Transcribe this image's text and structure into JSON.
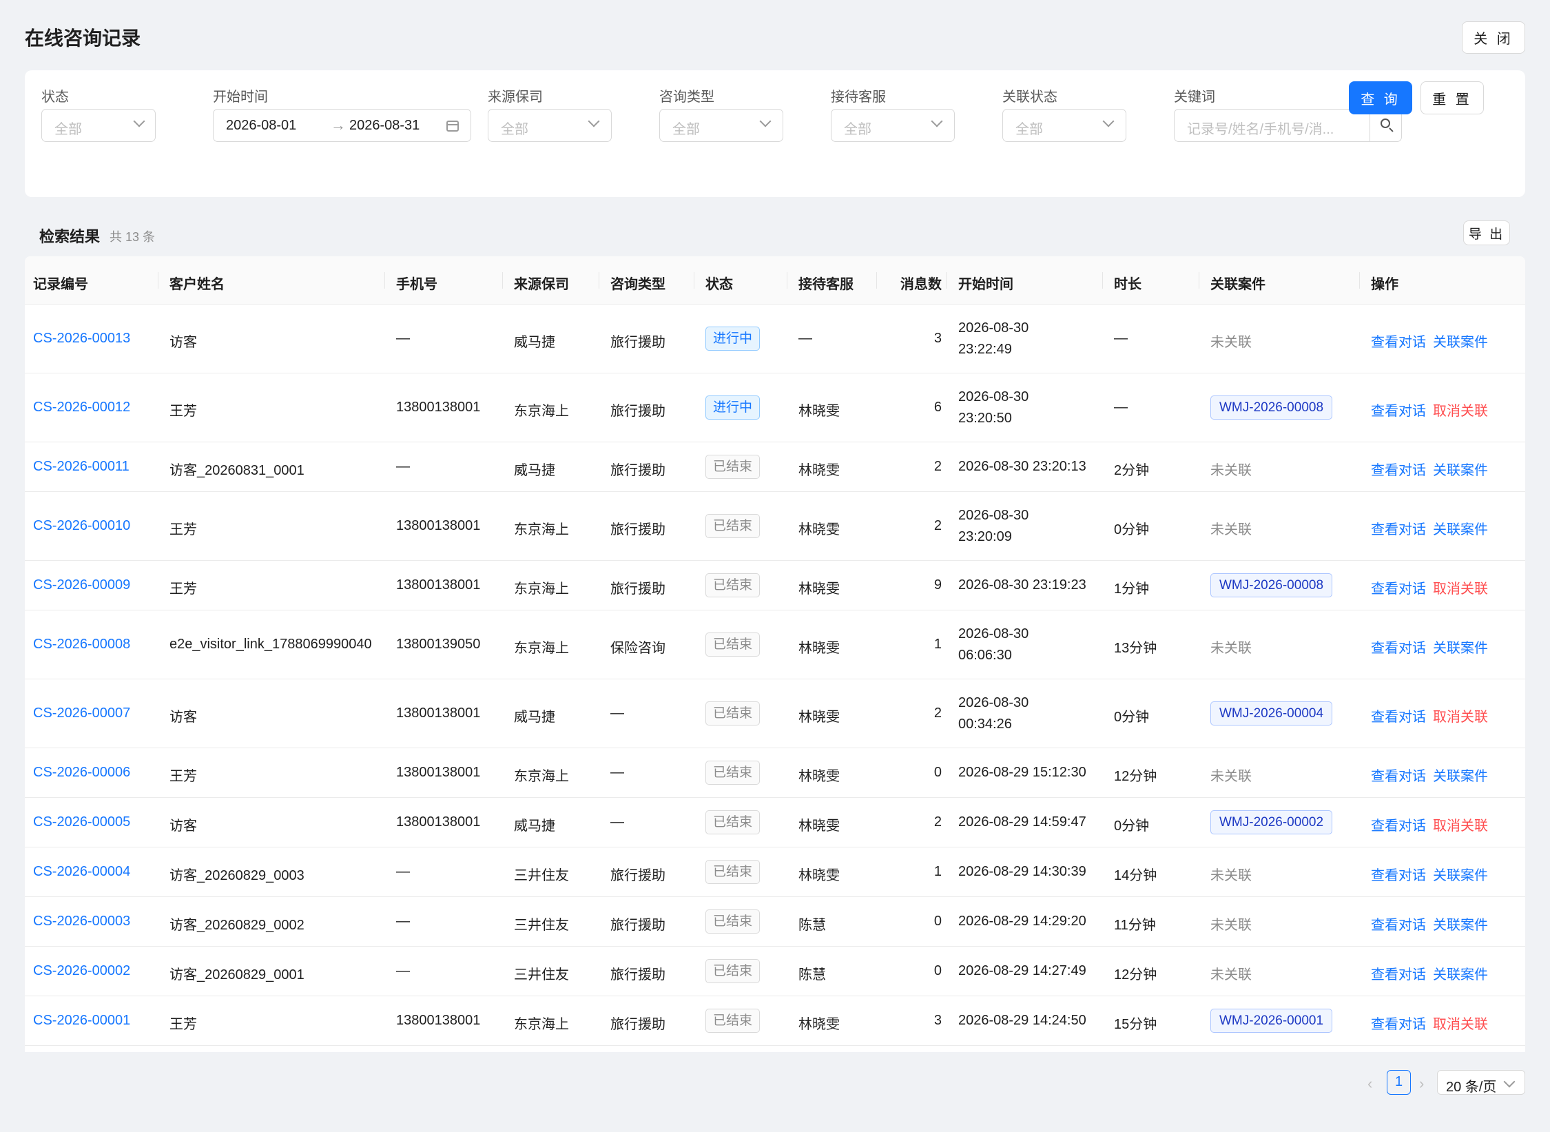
{
  "page": {
    "title": "在线咨询记录",
    "close_label": "关 闭"
  },
  "filters": {
    "status": {
      "label": "状态",
      "placeholder": "全部"
    },
    "start_time": {
      "label": "开始时间",
      "from": "2026-08-01",
      "to": "2026-08-31"
    },
    "insurer": {
      "label": "来源保司",
      "placeholder": "全部"
    },
    "consult_type": {
      "label": "咨询类型",
      "placeholder": "全部"
    },
    "agent": {
      "label": "接待客服",
      "placeholder": "全部"
    },
    "link_status": {
      "label": "关联状态",
      "placeholder": "全部"
    },
    "keyword": {
      "label": "关键词",
      "placeholder": "记录号/姓名/手机号/消..."
    },
    "query_label": "查 询",
    "reset_label": "重 置"
  },
  "results": {
    "title": "检索结果",
    "count": "共 13 条",
    "export_label": "导 出"
  },
  "table": {
    "columns": [
      "记录编号",
      "客户姓名",
      "手机号",
      "来源保司",
      "咨询类型",
      "状态",
      "接待客服",
      "消息数",
      "开始时间",
      "时长",
      "关联案件",
      "操作"
    ],
    "rows": [
      {
        "id": "CS-2026-00013",
        "name": "访客",
        "phone": "—",
        "insurer": "威马捷",
        "type": "旅行援助",
        "status": "进行中",
        "running": true,
        "agent": "—",
        "messages": "3",
        "date": "2026-08-30",
        "clock": "23:22:49",
        "duration": "—",
        "case": "未关联",
        "linked": false,
        "view": "查看对话",
        "action": "关联案件"
      },
      {
        "id": "CS-2026-00012",
        "name": "王芳",
        "phone": "13800138001",
        "insurer": "东京海上",
        "type": "旅行援助",
        "status": "进行中",
        "running": true,
        "agent": "林晓雯",
        "messages": "6",
        "date": "2026-08-30",
        "clock": "23:20:50",
        "duration": "—",
        "case": "WMJ-2026-00008",
        "linked": true,
        "view": "查看对话",
        "action": "取消关联"
      },
      {
        "id": "CS-2026-00011",
        "name": "访客_20260831_0001",
        "phone": "—",
        "insurer": "威马捷",
        "type": "旅行援助",
        "status": "已结束",
        "running": false,
        "agent": "林晓雯",
        "messages": "2",
        "datetime": "2026-08-30 23:20:13",
        "duration": "2分钟",
        "case": "未关联",
        "linked": false,
        "view": "查看对话",
        "action": "关联案件"
      },
      {
        "id": "CS-2026-00010",
        "name": "王芳",
        "phone": "13800138001",
        "insurer": "东京海上",
        "type": "旅行援助",
        "status": "已结束",
        "running": false,
        "agent": "林晓雯",
        "messages": "2",
        "date": "2026-08-30",
        "clock": "23:20:09",
        "duration": "0分钟",
        "case": "未关联",
        "linked": false,
        "view": "查看对话",
        "action": "关联案件"
      },
      {
        "id": "CS-2026-00009",
        "name": "王芳",
        "phone": "13800138001",
        "insurer": "东京海上",
        "type": "旅行援助",
        "status": "已结束",
        "running": false,
        "agent": "林晓雯",
        "messages": "9",
        "datetime": "2026-08-30 23:19:23",
        "duration": "1分钟",
        "case": "WMJ-2026-00008",
        "linked": true,
        "view": "查看对话",
        "action": "取消关联"
      },
      {
        "id": "CS-2026-00008",
        "name": "e2e_visitor_link_1788069990040",
        "phone": "13800139050",
        "insurer": "东京海上",
        "type": "保险咨询",
        "status": "已结束",
        "running": false,
        "agent": "林晓雯",
        "messages": "1",
        "date": "2026-08-30",
        "clock": "06:06:30",
        "duration": "13分钟",
        "case": "未关联",
        "linked": false,
        "view": "查看对话",
        "action": "关联案件"
      },
      {
        "id": "CS-2026-00007",
        "name": "访客",
        "phone": "13800138001",
        "insurer": "威马捷",
        "type": "—",
        "status": "已结束",
        "running": false,
        "agent": "林晓雯",
        "messages": "2",
        "date": "2026-08-30",
        "clock": "00:34:26",
        "duration": "0分钟",
        "case": "WMJ-2026-00004",
        "linked": true,
        "view": "查看对话",
        "action": "取消关联"
      },
      {
        "id": "CS-2026-00006",
        "name": "王芳",
        "phone": "13800138001",
        "insurer": "东京海上",
        "type": "—",
        "status": "已结束",
        "running": false,
        "agent": "林晓雯",
        "messages": "0",
        "datetime": "2026-08-29 15:12:30",
        "duration": "12分钟",
        "case": "未关联",
        "linked": false,
        "view": "查看对话",
        "action": "关联案件"
      },
      {
        "id": "CS-2026-00005",
        "name": "访客",
        "phone": "13800138001",
        "insurer": "威马捷",
        "type": "—",
        "status": "已结束",
        "running": false,
        "agent": "林晓雯",
        "messages": "2",
        "datetime": "2026-08-29 14:59:47",
        "duration": "0分钟",
        "case": "WMJ-2026-00002",
        "linked": true,
        "view": "查看对话",
        "action": "取消关联"
      },
      {
        "id": "CS-2026-00004",
        "name": "访客_20260829_0003",
        "phone": "—",
        "insurer": "三井住友",
        "type": "旅行援助",
        "status": "已结束",
        "running": false,
        "agent": "林晓雯",
        "messages": "1",
        "datetime": "2026-08-29 14:30:39",
        "duration": "14分钟",
        "case": "未关联",
        "linked": false,
        "view": "查看对话",
        "action": "关联案件"
      },
      {
        "id": "CS-2026-00003",
        "name": "访客_20260829_0002",
        "phone": "—",
        "insurer": "三井住友",
        "type": "旅行援助",
        "status": "已结束",
        "running": false,
        "agent": "陈慧",
        "messages": "0",
        "datetime": "2026-08-29 14:29:20",
        "duration": "11分钟",
        "case": "未关联",
        "linked": false,
        "view": "查看对话",
        "action": "关联案件"
      },
      {
        "id": "CS-2026-00002",
        "name": "访客_20260829_0001",
        "phone": "—",
        "insurer": "三井住友",
        "type": "旅行援助",
        "status": "已结束",
        "running": false,
        "agent": "陈慧",
        "messages": "0",
        "datetime": "2026-08-29 14:27:49",
        "duration": "12分钟",
        "case": "未关联",
        "linked": false,
        "view": "查看对话",
        "action": "关联案件"
      },
      {
        "id": "CS-2026-00001",
        "name": "王芳",
        "phone": "13800138001",
        "insurer": "东京海上",
        "type": "旅行援助",
        "status": "已结束",
        "running": false,
        "agent": "林晓雯",
        "messages": "3",
        "datetime": "2026-08-29 14:24:50",
        "duration": "15分钟",
        "case": "WMJ-2026-00001",
        "linked": true,
        "view": "查看对话",
        "action": "取消关联"
      }
    ]
  },
  "pagination": {
    "current_page": "1",
    "page_size": "20 条/页",
    "prev_icon": "chevron-left-icon",
    "next_icon": "chevron-right-icon"
  },
  "colors": {
    "primary": "#1677ff",
    "danger": "#ff4d4f",
    "page_bg": "#f0f2f5"
  }
}
